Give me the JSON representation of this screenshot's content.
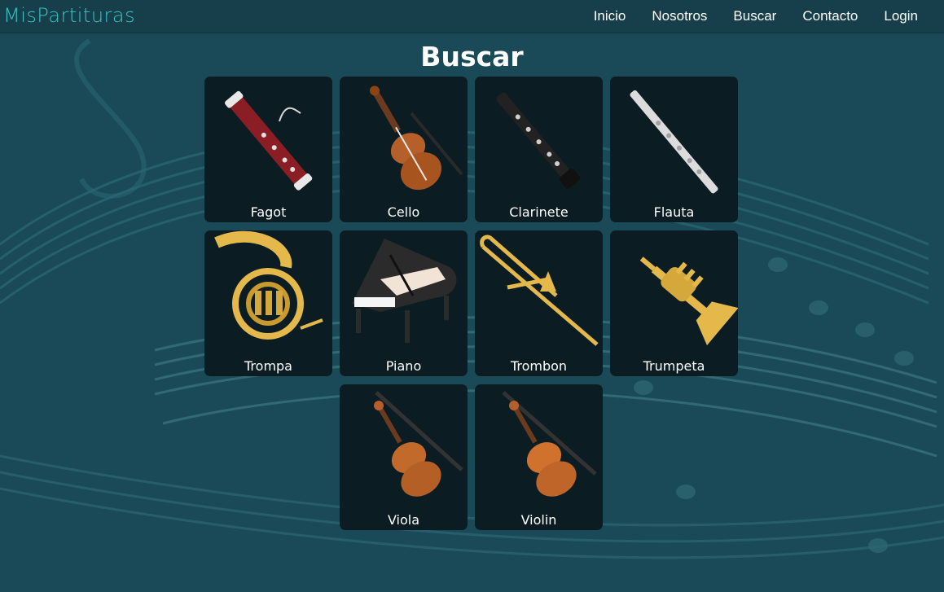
{
  "brand": {
    "name": "MisPartituras",
    "accent": "#36c3c2"
  },
  "nav": {
    "items": [
      {
        "label": "Inicio"
      },
      {
        "label": "Nosotros"
      },
      {
        "label": "Buscar"
      },
      {
        "label": "Contacto"
      },
      {
        "label": "Login"
      }
    ]
  },
  "page": {
    "title": "Buscar"
  },
  "instruments": [
    {
      "label": "Fagot",
      "icon": "bassoon-icon"
    },
    {
      "label": "Cello",
      "icon": "cello-icon"
    },
    {
      "label": "Clarinete",
      "icon": "clarinet-icon"
    },
    {
      "label": "Flauta",
      "icon": "flute-icon"
    },
    {
      "label": "Trompa",
      "icon": "french-horn-icon"
    },
    {
      "label": "Piano",
      "icon": "grand-piano-icon"
    },
    {
      "label": "Trombon",
      "icon": "trombone-icon"
    },
    {
      "label": "Trumpeta",
      "icon": "trumpet-icon"
    },
    {
      "label": "Viola",
      "icon": "viola-icon"
    },
    {
      "label": "Violin",
      "icon": "violin-icon"
    }
  ],
  "colors": {
    "background": "#1a4a57",
    "navbar": "#163f4b",
    "card": "#0b1d22",
    "text": "#ffffff"
  }
}
